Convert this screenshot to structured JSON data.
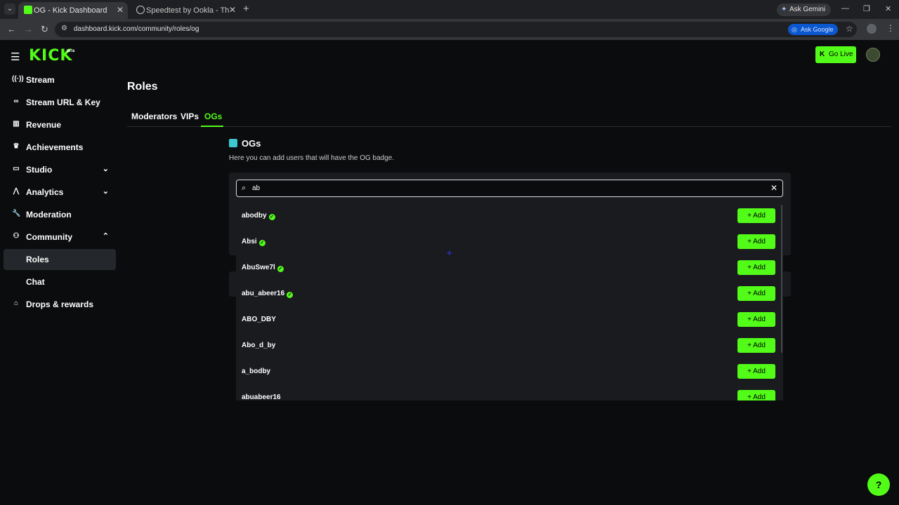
{
  "browser": {
    "tabs": [
      {
        "title": "OG - Kick Dashboard",
        "active": true
      },
      {
        "title": "Speedtest by Ookla - The Global",
        "active": false
      }
    ],
    "ask_gemini": "Ask Gemini",
    "url": "dashboard.kick.com/community/roles/og",
    "ask_google": "Ask Google"
  },
  "header": {
    "logo": "KICK",
    "logo_badge": "BETA",
    "go_live": "Go Live"
  },
  "sidebar": {
    "items": [
      {
        "label": "Stream",
        "icon": "broadcast-icon"
      },
      {
        "label": "Stream URL & Key",
        "icon": "link-icon"
      },
      {
        "label": "Revenue",
        "icon": "chart-bar-icon"
      },
      {
        "label": "Achievements",
        "icon": "trophy-icon"
      },
      {
        "label": "Studio",
        "icon": "studio-icon",
        "expandable": true
      },
      {
        "label": "Analytics",
        "icon": "analytics-icon",
        "expandable": true
      },
      {
        "label": "Moderation",
        "icon": "wrench-icon"
      },
      {
        "label": "Community",
        "icon": "community-icon",
        "expanded": true
      },
      {
        "label": "Roles",
        "sub": true,
        "active": true
      },
      {
        "label": "Chat",
        "sub": true
      },
      {
        "label": "Drops & rewards",
        "icon": "gift-icon"
      }
    ]
  },
  "main": {
    "title": "Roles",
    "tabs": [
      "Moderators",
      "VIPs",
      "OGs"
    ],
    "active_tab": "OGs",
    "section_title": "OGs",
    "section_desc": "Here you can add users that will have the OG badge.",
    "search_value": "ab",
    "results": [
      {
        "username": "abodby",
        "verified": true
      },
      {
        "username": "Absi",
        "verified": true
      },
      {
        "username": "AbuSwe7l",
        "verified": true
      },
      {
        "username": "abu_abeer16",
        "verified": true
      },
      {
        "username": "ABO_DBY",
        "verified": false
      },
      {
        "username": "Abo_d_by",
        "verified": false
      },
      {
        "username": "a_bodby",
        "verified": false
      },
      {
        "username": "abuabeer16",
        "verified": false
      }
    ],
    "add_label": "Add"
  },
  "colors": {
    "accent": "#53fc18",
    "background": "#0b0c0d",
    "panel": "#191b1f"
  }
}
